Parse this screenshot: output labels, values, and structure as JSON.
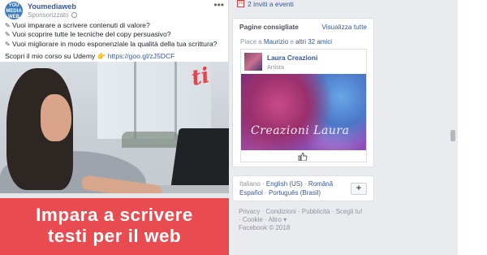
{
  "post": {
    "avatar_text": "YOU MEDIA WEB",
    "page_name": "Youmediaweb",
    "sponsored": "Sponsorizzato",
    "more": "•••",
    "lines": [
      "Vuoi imparare a scrivere contenuti di valore?",
      "Vuoi scoprire tutte le tecniche del copy persuasivo?",
      "Vuoi migliorare in modo esponenziale la qualità della tua scrittura?"
    ],
    "cta_text": "Scopri il mio corso su Udemy",
    "cta_emoji": "👉",
    "cta_link": "https://goo.gl/zJ5DCF",
    "image_logo": "ti",
    "banner_line1": "Impara a scrivere",
    "banner_line2": "testi per il web"
  },
  "sidebar": {
    "calendar_icon": "26",
    "invites": "2 inviti a eventi",
    "pages_title": "Pagine consigliate",
    "see_all": "Visualizza tutte",
    "likes_prefix": "Piace a",
    "likes_name": "Maurizio",
    "likes_conj": "e",
    "likes_others": "altri 32 amici",
    "rec_page_name": "Laura Creazioni",
    "rec_page_category": "Artista",
    "cover_text": "Creazioni Laura",
    "languages": {
      "current": "Italiano",
      "sep": " · ",
      "options": [
        "English (US)",
        "Română",
        "Español",
        "Português (Brasil)"
      ]
    },
    "add_language": "+",
    "footer_line1": "Privacy · Condizioni · Pubblicità · Scegli tu!",
    "footer_line2": "· Cookie · Altro ▾",
    "footer_line3": "Facebook © 2018"
  },
  "colors": {
    "link": "#365899",
    "banner": "#e84c50",
    "background": "#e9ebee"
  }
}
